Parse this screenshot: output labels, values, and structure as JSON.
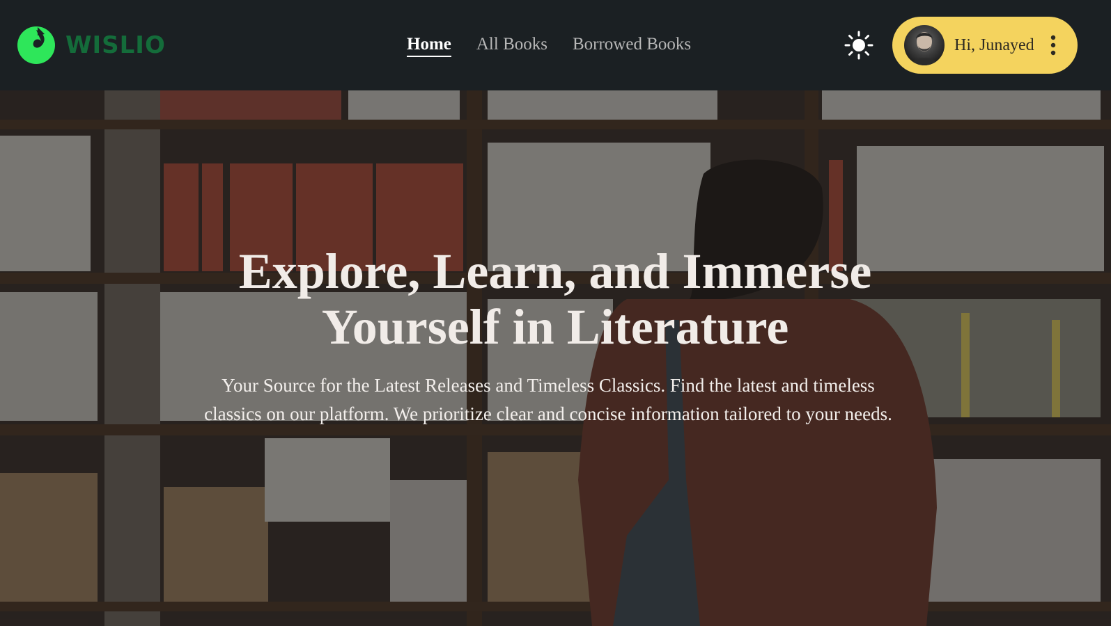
{
  "brand": {
    "name": "WISLIO",
    "accent": "#2ee65a",
    "text_color": "#146c3a"
  },
  "nav": {
    "items": [
      {
        "label": "Home",
        "active": true
      },
      {
        "label": "All Books",
        "active": false
      },
      {
        "label": "Borrowed Books",
        "active": false
      }
    ]
  },
  "header": {
    "theme_toggle_icon": "sun-icon",
    "user": {
      "greeting": "Hi, Junayed",
      "avatar_icon": "avatar",
      "menu_icon": "kebab-icon"
    },
    "pill_color": "#f4d35e",
    "background": "#1b2023"
  },
  "hero": {
    "title_line1": "Explore, Learn, and Immerse",
    "title_line2": "Yourself in Literature",
    "subtitle": "Your Source for the Latest Releases and Timeless Classics. Find the latest and timeless classics on our platform. We prioritize clear and concise information tailored to your needs."
  }
}
